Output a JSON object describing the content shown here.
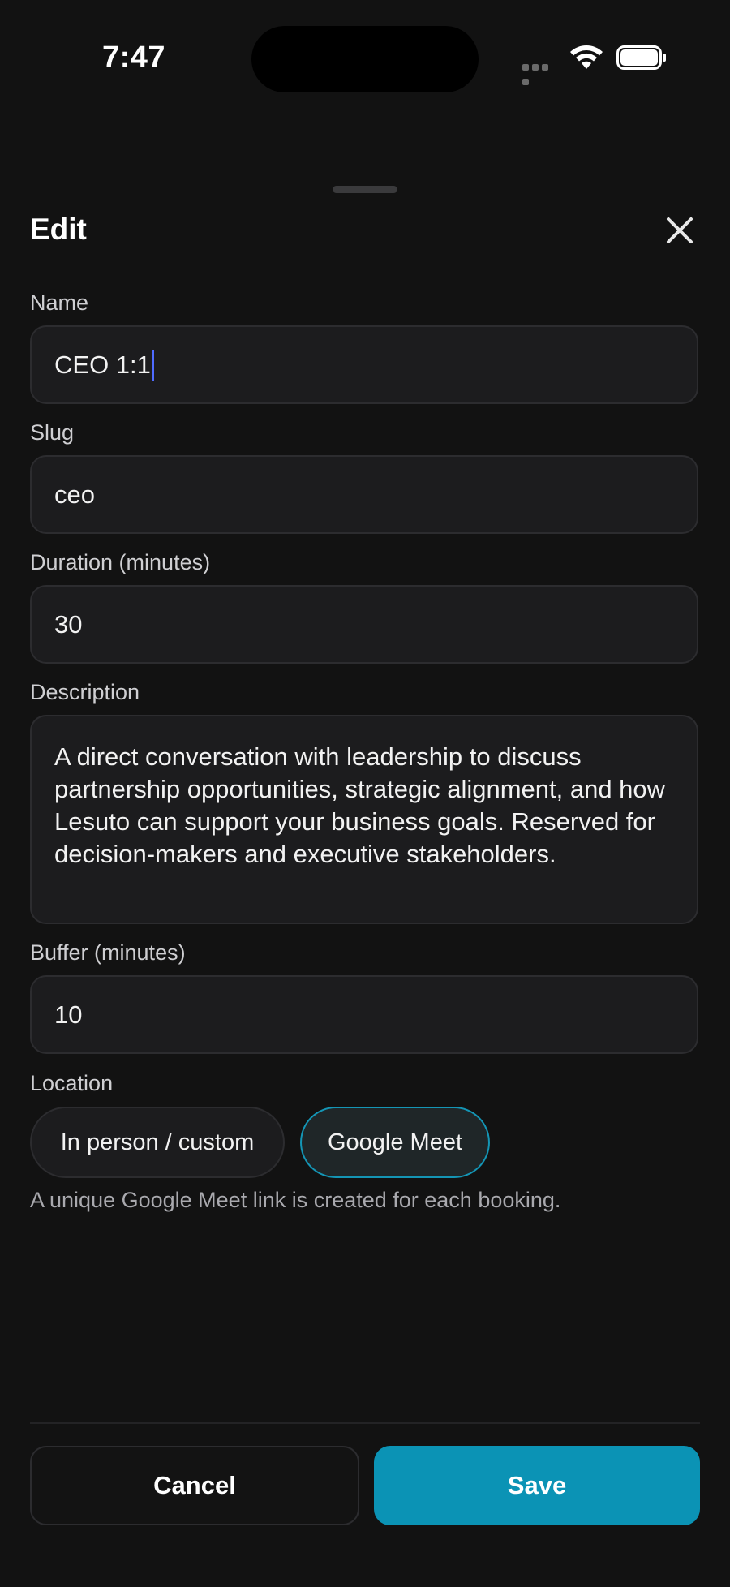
{
  "status_bar": {
    "time": "7:47"
  },
  "sheet": {
    "title": "Edit",
    "close_icon": "close-icon"
  },
  "fields": {
    "name": {
      "label": "Name",
      "value": "CEO 1:1"
    },
    "slug": {
      "label": "Slug",
      "value": "ceo"
    },
    "duration": {
      "label": "Duration (minutes)",
      "value": "30"
    },
    "description": {
      "label": "Description",
      "value": "A direct conversation with leadership to discuss partnership opportunities, strategic alignment, and how Lesuto can support your business goals. Reserved for decision-makers and executive stakeholders."
    },
    "buffer": {
      "label": "Buffer (minutes)",
      "value": "10"
    }
  },
  "location": {
    "label": "Location",
    "options": [
      {
        "label": "In person / custom",
        "selected": false
      },
      {
        "label": "Google Meet",
        "selected": true
      }
    ],
    "helper": "A unique Google Meet link is created for each booking."
  },
  "actions": {
    "cancel_label": "Cancel",
    "save_label": "Save"
  },
  "colors": {
    "background": "#121212",
    "field_background": "#1c1c1e",
    "accent": "#0b93b5",
    "caret": "#4f6bff"
  }
}
